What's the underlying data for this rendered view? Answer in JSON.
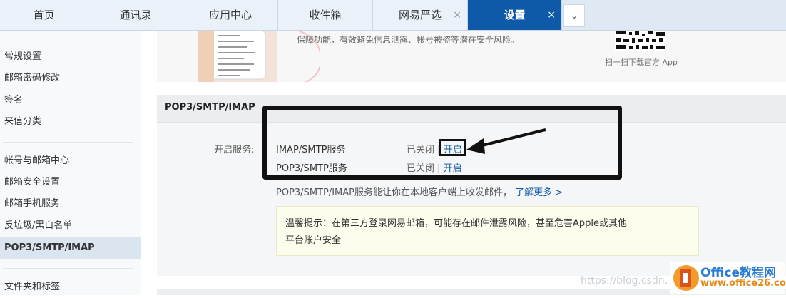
{
  "tabs": [
    {
      "label": "首页",
      "closable": false,
      "active": false
    },
    {
      "label": "通讯录",
      "closable": false,
      "active": false
    },
    {
      "label": "应用中心",
      "closable": false,
      "active": false
    },
    {
      "label": "收件箱",
      "closable": false,
      "active": false
    },
    {
      "label": "网易严选",
      "closable": true,
      "active": false
    },
    {
      "label": "设置",
      "closable": true,
      "active": true
    }
  ],
  "tab_close_glyph": "×",
  "tab_more_glyph": "⌄",
  "sidebar": {
    "items": [
      {
        "label": "常规设置"
      },
      {
        "label": "邮箱密码修改"
      },
      {
        "label": "签名"
      },
      {
        "label": "来信分类"
      },
      {
        "label": "帐号与邮箱中心"
      },
      {
        "label": "邮箱安全设置"
      },
      {
        "label": "邮箱手机服务"
      },
      {
        "label": "反垃圾/黑白名单"
      },
      {
        "label": "POP3/SMTP/IMAP",
        "active": true
      },
      {
        "label": "文件夹和标签"
      }
    ]
  },
  "promo": {
    "text": "保障功能，有效避免信息泄露、帐号被盗等潜在安全风险。",
    "qr_caption": "扫一扫下载官方 App"
  },
  "section": {
    "title": "POP3/SMTP/IMAP",
    "open_label": "开启服务:",
    "services": [
      {
        "name": "IMAP/SMTP服务",
        "status": "已关闭",
        "separator": "|",
        "action": "开启"
      },
      {
        "name": "POP3/SMTP服务",
        "status": "已关闭",
        "separator": "|",
        "action": "开启"
      }
    ],
    "description": "POP3/SMTP/IMAP服务能让你在本地客户端上收发邮件，",
    "learn_more": "了解更多 >",
    "tip_line1": "温馨提示：在第三方登录网易邮箱，可能存在邮件泄露风险，甚至危害Apple或其他",
    "tip_line2": "平台账户安全"
  },
  "watermark": {
    "csdn": "https://blog.csdn.",
    "brand": "Office教程网",
    "url": "www.office26.com"
  },
  "colors": {
    "accent": "#0e5aa8",
    "tabbar": "#dfe9f4",
    "sidebar": "#f7f9fb",
    "sidebar_active": "#dbe5f0",
    "tip_bg": "#fdfdee",
    "annotation": "#111111"
  }
}
